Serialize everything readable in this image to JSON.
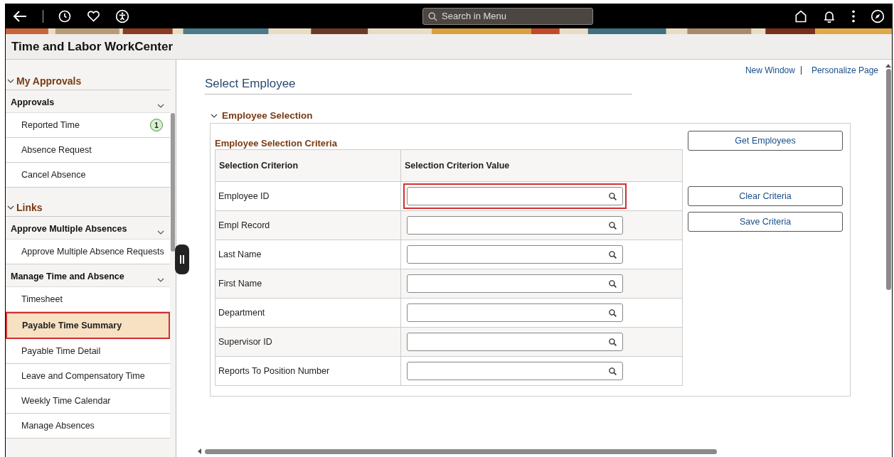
{
  "topbar": {
    "search": {
      "placeholder": "Search in Menu"
    }
  },
  "header": {
    "title": "Time and Labor WorkCenter"
  },
  "sidebar": {
    "sections": [
      {
        "title": "My Approvals",
        "expanded": true,
        "groups": [
          {
            "title": "Approvals",
            "items": [
              {
                "label": "Reported Time",
                "badge": "1",
                "selected": false
              },
              {
                "label": "Absence Request",
                "selected": false
              },
              {
                "label": "Cancel Absence",
                "selected": false
              }
            ]
          }
        ]
      },
      {
        "title": "Links",
        "expanded": true,
        "groups": [
          {
            "title": "Approve Multiple Absences",
            "items": [
              {
                "label": "Approve Multiple Absence Requests",
                "selected": false
              }
            ]
          },
          {
            "title": "Manage Time and Absence",
            "items": [
              {
                "label": "Timesheet",
                "selected": false
              },
              {
                "label": "Payable Time Summary",
                "selected": true
              },
              {
                "label": "Payable Time Detail",
                "selected": false
              },
              {
                "label": "Leave and Compensatory Time",
                "selected": false
              },
              {
                "label": "Weekly Time Calendar",
                "selected": false
              },
              {
                "label": "Manage Absences",
                "selected": false
              }
            ]
          }
        ]
      }
    ]
  },
  "page_links": [
    "New Window",
    "Personalize Page"
  ],
  "page_title": "Select Employee",
  "section": {
    "title": "Employee Selection",
    "expanded": true,
    "grid_title": "Employee Selection Criteria",
    "columns": [
      "Selection Criterion",
      "Selection Criterion Value"
    ],
    "rows": [
      {
        "criterion": "Employee ID",
        "highlighted": true
      },
      {
        "criterion": "Empl Record",
        "highlighted": false
      },
      {
        "criterion": "Last Name",
        "highlighted": false
      },
      {
        "criterion": "First Name",
        "highlighted": false
      },
      {
        "criterion": "Department",
        "highlighted": false
      },
      {
        "criterion": "Supervisor ID",
        "highlighted": false
      },
      {
        "criterion": "Reports To Position Number",
        "highlighted": false
      }
    ],
    "buttons": [
      "Get Employees",
      "Clear Criteria",
      "Save Criteria"
    ]
  }
}
